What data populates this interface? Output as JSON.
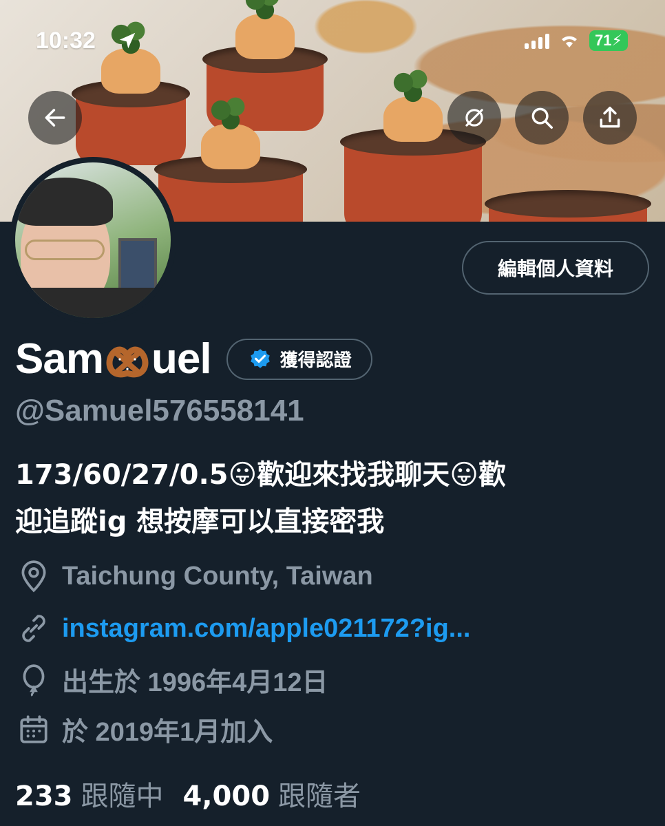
{
  "status_bar": {
    "time": "10:32",
    "battery": "71"
  },
  "header": {
    "back_icon": "arrow-left-icon",
    "actions": [
      "grok-icon",
      "search-icon",
      "share-icon"
    ]
  },
  "profile": {
    "edit_button_label": "編輯個人資料",
    "name_before": "Sam",
    "name_emoji": "🥨",
    "name_after": "uel",
    "verified_label": "獲得認證",
    "handle": "@Samuel576558141",
    "bio_line1": "173/60/27/0.5😛歡迎來找我聊天😛歡",
    "bio_line2": "迎追蹤ig 想按摩可以直接密我",
    "location": "Taichung County, Taiwan",
    "website": "instagram.com/apple021172?ig...",
    "birthday": "出生於 1996年4月12日",
    "joined": "於 2019年1月加入",
    "following_count": "233",
    "following_label": "跟隨中",
    "followers_count": "4,000",
    "followers_label": "跟隨者"
  },
  "colors": {
    "background": "#15202b",
    "accent": "#1d9bf0",
    "secondary_text": "#8b98a5",
    "border": "#536471"
  }
}
